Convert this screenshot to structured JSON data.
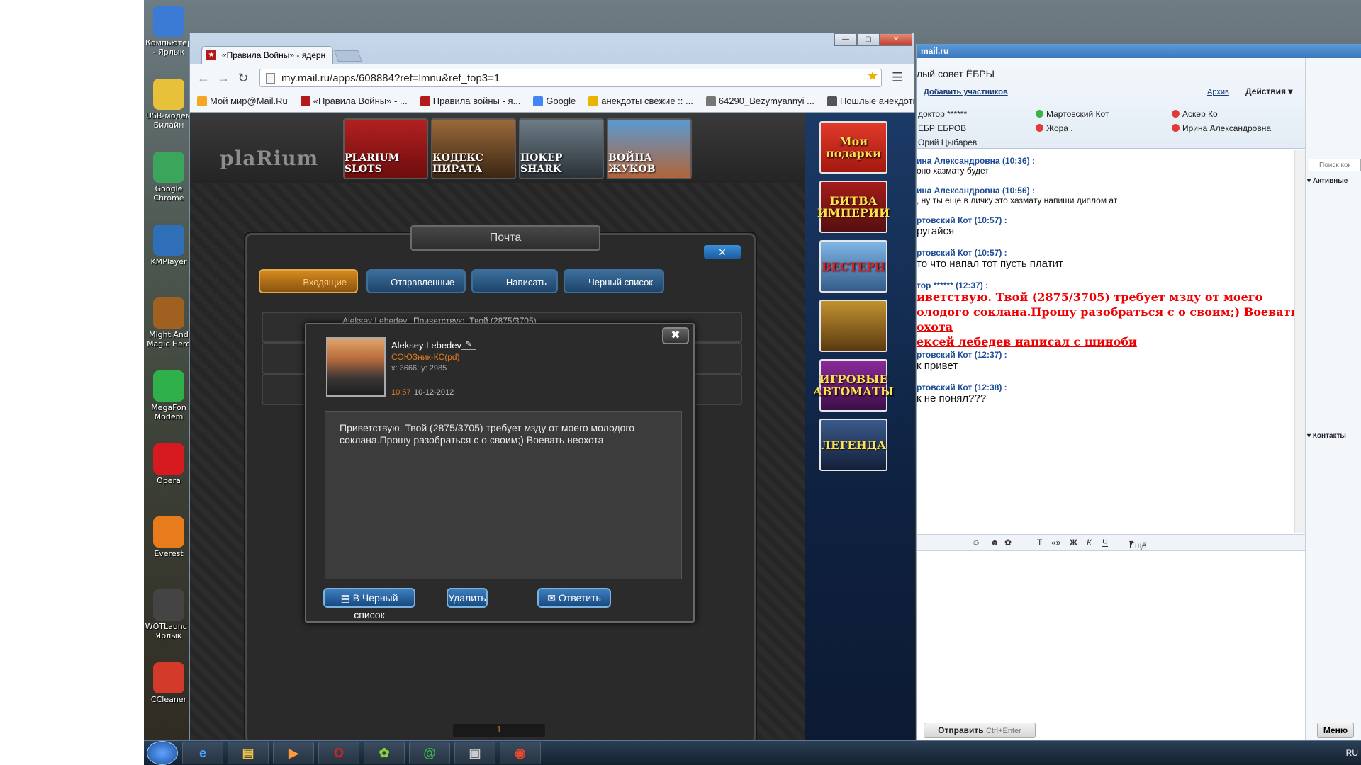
{
  "desktop": {
    "icons": [
      {
        "label": "Компьютер - Ярлык",
        "icon": "computer-icon",
        "color": "#3b7bd6"
      },
      {
        "label": "USB-модем Билайн",
        "icon": "usb-modem-icon",
        "color": "#e8c13a"
      },
      {
        "label": "Google Chrome",
        "icon": "chrome-icon",
        "color": "#3ba55c"
      },
      {
        "label": "KMPlayer",
        "icon": "kmplayer-icon",
        "color": "#2f6fb8"
      },
      {
        "label": "Might And Magic Hero",
        "icon": "dragon-icon",
        "color": "#a06020"
      },
      {
        "label": "MegaFon Modem",
        "icon": "megafon-icon",
        "color": "#2fb04a"
      },
      {
        "label": "Opera",
        "icon": "opera-icon",
        "color": "#d71920"
      },
      {
        "label": "Everest",
        "icon": "everest-icon",
        "color": "#e87b1b"
      },
      {
        "label": "WOTLaunc - Ярлык",
        "icon": "wot-icon",
        "color": "#444444"
      },
      {
        "label": "CCleaner",
        "icon": "ccleaner-icon",
        "color": "#d43a2a"
      }
    ]
  },
  "taskbar": {
    "tray_text": "RU"
  },
  "browser": {
    "tab_title": "«Правила Войны» - ядерн",
    "url": "my.mail.ru/apps/608884?ref=lmnu&ref_top3=1",
    "bookmarks": [
      {
        "label": "Мой мир@Mail.Ru",
        "color": "#f5a623"
      },
      {
        "label": "«Правила Войны» - ...",
        "color": "#b31a1a"
      },
      {
        "label": "Правила войны - я...",
        "color": "#b31a1a"
      },
      {
        "label": "Google",
        "color": "#4285f4"
      },
      {
        "label": "анекдоты свежие :: ...",
        "color": "#e8b400"
      },
      {
        "label": "64290_Bezymyannyi ...",
        "color": "#777777"
      },
      {
        "label": "Пошлые анекдоты",
        "color": "#555555"
      }
    ]
  },
  "game": {
    "logo": "plaRium",
    "thumbs": [
      "PLARIUM SLOTS",
      "КОДЕКС ПИРАТА",
      "ПОКЕР SHARK",
      "ВОЙНА ЖУКОВ"
    ],
    "ads": [
      "Мои подарки",
      "БИТВА ИМПЕРИИ",
      "ВЕСТЕРН",
      "",
      "ИГРОВЫЕ АВТОМАТЫ",
      "ЛЕГЕНДА"
    ],
    "mail": {
      "title": "Почта",
      "tabs": [
        "Входящие",
        "Отправленные",
        "Написать",
        "Черный список"
      ],
      "rows": [
        {
          "sender": "Aleksey Lebedev",
          "preview": "Приветствую. Твой (2875/3705) требует мзду от моего молодого"
        }
      ],
      "page": "1"
    },
    "dialog": {
      "name": "Aleksey Lebedev",
      "clan": "СОЮЗник-КС(pd)",
      "coords": "x: 3666; y: 2985",
      "time": "10:57",
      "date": "10-12-2012",
      "message": "Приветствую. Твой (2875/3705) требует мзду от моего молодого соклана.Прошу разобраться с о своим;) Воевать неохота",
      "btn_blacklist": "В Черный список",
      "btn_delete": "Удалить",
      "btn_reply": "Ответить"
    }
  },
  "agent": {
    "brand": "mail.ru",
    "chat_title": "лый совет ЁБРЫ",
    "add_participants": "Добавить участников",
    "archive": "Архив",
    "actions": "Действия",
    "participants": [
      "доктор ******",
      "Мартовский Кот",
      "Аскер Ко",
      "ЕБР ЕБРОВ",
      "Жора .",
      "Ирина Александровна",
      "Орий Цыбарев"
    ],
    "messages": [
      {
        "header": "ина Александровна (10:36) :",
        "text": "оно хазмату будет",
        "style": "normal"
      },
      {
        "header": "ина Александровна (10:56) :",
        "text": ", ну ты еще в личку это хазмату напиши диплом ат",
        "style": "normal"
      },
      {
        "header": "ртовский Кот (10:57) :",
        "text": "ругайся",
        "style": "big"
      },
      {
        "header": "ртовский Кот (10:57) :",
        "text": "то что напал тот пусть платит",
        "style": "big"
      },
      {
        "header": "тор ****** (12:37) :",
        "text": "иветствую. Твой (2875/3705) требует мзду от моего",
        "style": "red"
      },
      {
        "header": "",
        "text": "олодого соклана.Прошу разобраться с о своим;) Воевать",
        "style": "red"
      },
      {
        "header": "",
        "text": "охота",
        "style": "red"
      },
      {
        "header": "",
        "text": "ексей лебедев написал с шиноби",
        "style": "red"
      },
      {
        "header": "ртовский Кот (12:37) :",
        "text": "к привет",
        "style": "big"
      },
      {
        "header": "ртовский Кот (12:38) :",
        "text": "к не понял???",
        "style": "big"
      }
    ],
    "format_more": "Ещё",
    "send": "Отправить",
    "send_hint": "Ctrl+Enter",
    "right": {
      "search_placeholder": "Поиск конт",
      "group_active": "Активные",
      "group_contacts": "Контакты",
      "menu": "Меню"
    }
  }
}
